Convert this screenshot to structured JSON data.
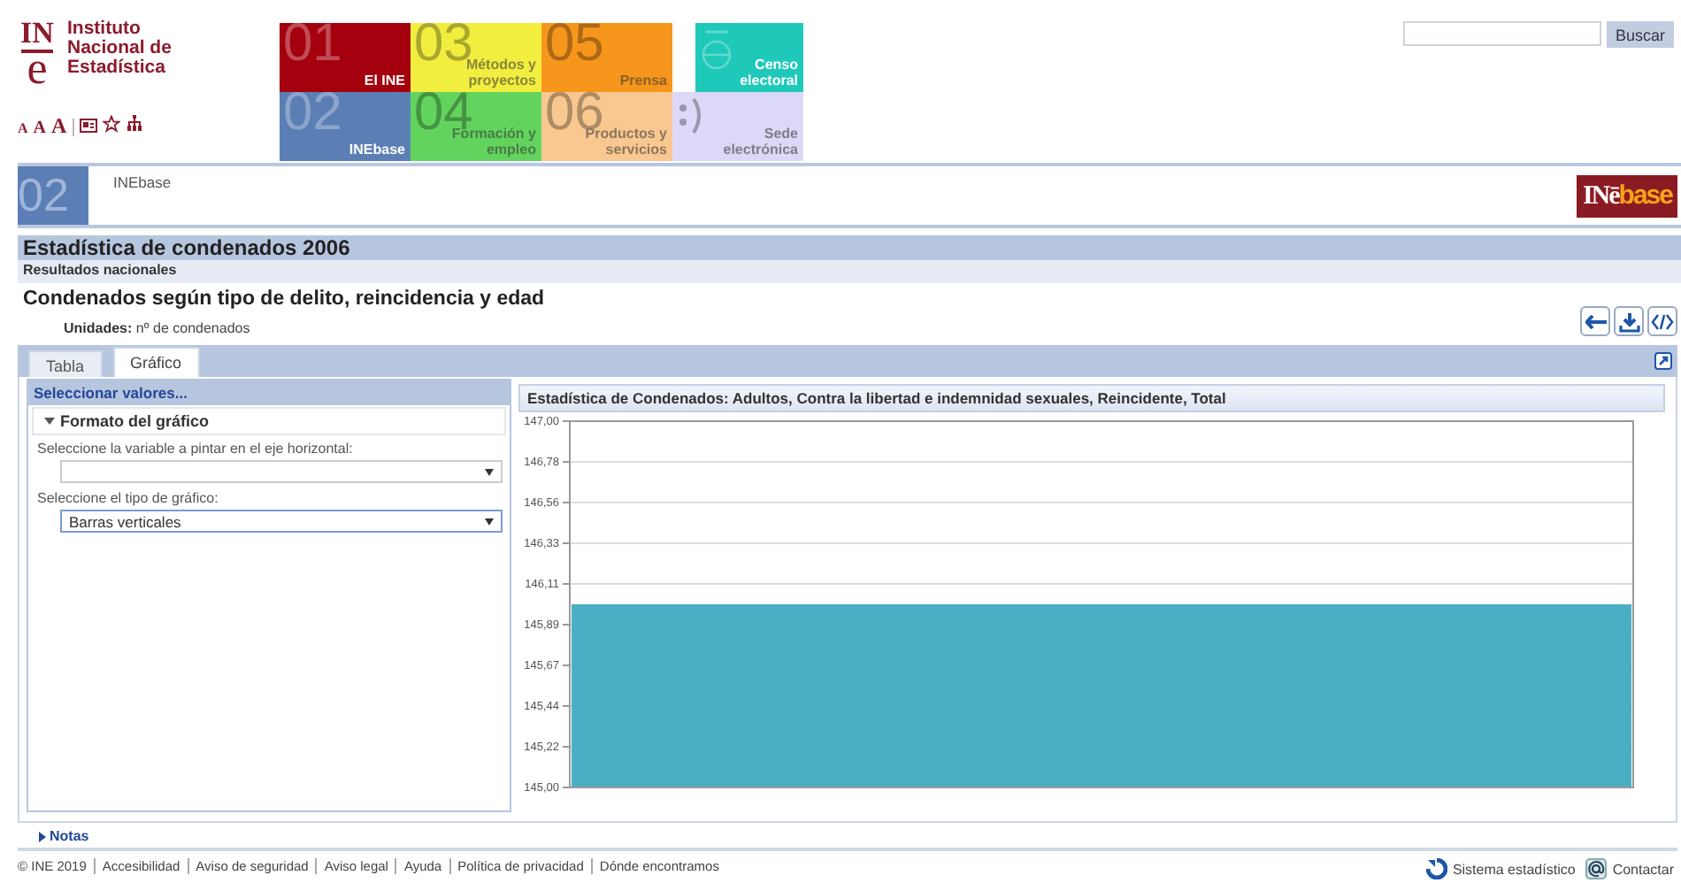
{
  "logo": {
    "mark_top": "IN",
    "mark_bottom": "e",
    "name_lines": [
      "Instituto",
      "Nacional de",
      "Estadística"
    ]
  },
  "text_size_buttons": [
    "A",
    "A",
    "A"
  ],
  "nav_tiles": [
    {
      "kind": "numbered",
      "number": "01",
      "label": "El INE",
      "color": "#a5000d"
    },
    {
      "kind": "numbered",
      "number": "02",
      "label": "INEbase",
      "color": "#5b7fb5"
    },
    {
      "kind": "numbered",
      "number": "03",
      "label": "Métodos y proyectos",
      "color": "#f2ee40"
    },
    {
      "kind": "numbered",
      "number": "04",
      "label": "Formación y empleo",
      "color": "#62d45e"
    },
    {
      "kind": "numbered",
      "number": "05",
      "label": "Prensa",
      "color": "#f7961d"
    },
    {
      "kind": "numbered",
      "number": "06",
      "label": "Productos y servicios",
      "color": "#f9c890"
    },
    {
      "kind": "census",
      "label": "Censo electoral",
      "color": "#1fc9b9"
    },
    {
      "kind": "portal",
      "label": "Sede electrónica",
      "color": "#dcd8f7"
    }
  ],
  "search": {
    "button": "Buscar"
  },
  "section": {
    "number": "02",
    "label": "INEbase"
  },
  "brand_logo": {
    "prefix": "INē",
    "suffix": "base"
  },
  "title": "Estadística de condenados 2006",
  "subtitle": "Resultados nacionales",
  "table_title": "Condenados según tipo de delito, reincidencia y edad",
  "units": {
    "label": "Unidades:",
    "value": "nº de condenados"
  },
  "tabs": [
    {
      "label": "Tabla",
      "selected": false
    },
    {
      "label": "Gráfico",
      "selected": true
    }
  ],
  "options_panel": {
    "header": "Seleccionar valores...",
    "section": "Formato del gráfico",
    "expanded": true,
    "fields": [
      {
        "label": "Seleccione la variable a pintar en el eje horizontal:",
        "focused": false
      },
      {
        "label": "Seleccione el tipo de gráfico:",
        "value": "Barras verticales",
        "focused": true
      }
    ]
  },
  "chart_data": {
    "type": "bar",
    "title": "Estadística de Condenados: Adultos, Contra la libertad e indemnidad sexuales, Reincidente, Total",
    "series": [
      {
        "color": "#4aaec4",
        "values": [
          146
        ]
      }
    ],
    "grid": true,
    "ylim": [
      145,
      147
    ],
    "yticks": [
      {
        "value": 145,
        "label": "145,00"
      },
      {
        "value": 145.222,
        "label": "145,22"
      },
      {
        "value": 145.444,
        "label": "145,44"
      },
      {
        "value": 145.667,
        "label": "145,67"
      },
      {
        "value": 145.889,
        "label": "145,89"
      },
      {
        "value": 146.111,
        "label": "146,11"
      },
      {
        "value": 146.333,
        "label": "146,33"
      },
      {
        "value": 146.556,
        "label": "146,56"
      },
      {
        "value": 146.778,
        "label": "146,78"
      },
      {
        "value": 147,
        "label": "147,00"
      }
    ]
  },
  "notes": "Notas",
  "footer": {
    "links": [
      "© INE 2019",
      "Accesibilidad",
      "Aviso de seguridad",
      "Aviso legal",
      "Ayuda",
      "Política de privacidad",
      "Dónde encontramos"
    ],
    "right_links": [
      "Sistema estadístico",
      "Contactar"
    ]
  }
}
